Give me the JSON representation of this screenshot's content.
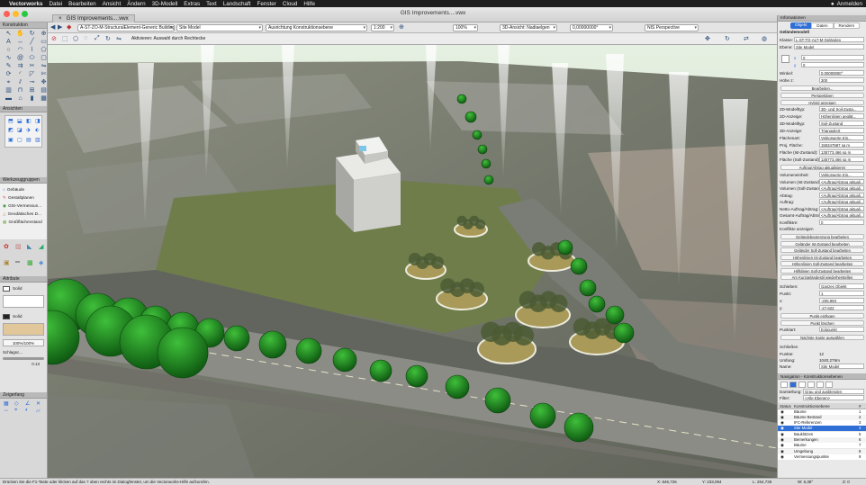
{
  "menubar": {
    "app": "Vectorworks",
    "items": [
      "Datei",
      "Bearbeiten",
      "Ansicht",
      "Ändern",
      "3D-Modell",
      "Extras",
      "Text",
      "Landschaft",
      "Fenster",
      "Cloud",
      "Hilfe"
    ],
    "user": "Anmelden"
  },
  "window": {
    "title": "GIS Improvements....vwx",
    "tab": "GIS Improvements....vwx",
    "tab_close": "×"
  },
  "view_bar": {
    "class": "A-ST-ZO-M-StructuralElement-Generic Building",
    "layer": "Site Model",
    "alignment": "Ausrichtung Konstruktionsebene",
    "scale": "1:200",
    "zoom": "100%",
    "view": "3D-Ansicht: Nadiaelgen",
    "angle": "0,00000000°",
    "projection": "NIS Perspective"
  },
  "mode_bar": {
    "hint": "Aktivieren: Auswahl durch Rechtecke"
  },
  "left_panels": {
    "construction": "Konstruktion",
    "views": "Ansichten",
    "toolsets": "Werkzeuggruppen",
    "toolset_items": [
      "Gebäude",
      "Gestaltplanen",
      "GIS-Vermessun...",
      "Geodätisches D...",
      "Großflächenstand"
    ],
    "attributes": "Attribute",
    "fill_label": "Solid",
    "pen_label": "Solid",
    "opacity": "100%/100%",
    "shadow": "Schlagsc...",
    "line_value": "0.13",
    "snapping": "Zeigerfang"
  },
  "info_panel": {
    "title": "Infomationen",
    "tabs": [
      "Objekt",
      "Daten",
      "Rendern"
    ],
    "object": "Geländemodell",
    "klasse_label": "Klasse:",
    "klasse": "L-ST-TO-ALT-M-Geländes",
    "ebene_label": "Ebene:",
    "ebene": "Site Model",
    "x_val": "0",
    "y_val": "0",
    "rows": [
      {
        "label": "Winkel:",
        "value": "0,00000000°"
      },
      {
        "label": "Höhe z:",
        "value": "300"
      }
    ],
    "buttons_top": [
      "Bearbeiten...",
      "Perspektiven",
      "Hybrid anzeigen"
    ],
    "settings": [
      {
        "label": "2D-Modelltyp:",
        "value": "3D- und Soil-Zusta..."
      },
      {
        "label": "2D-Anzeige:",
        "value": "Höhenlinien geglät..."
      },
      {
        "label": "3D-Modelltyp:",
        "value": "Soil-Zustand"
      },
      {
        "label": "3D-Anzeige:",
        "value": "Trianguliert"
      },
      {
        "label": "Flächenart:",
        "value": "Vektorwerte Ein..."
      },
      {
        "label": "Proj. Fläche:",
        "value": "155347587 sq m"
      },
      {
        "label": "Fläche (Ist-Zustand):",
        "value": "135773,466 sq m"
      },
      {
        "label": "Fläche (Soll-Zustand):",
        "value": "135773,466 sq m"
      }
    ],
    "btn_fill": "Auftrag/Abtrag aktualisieren",
    "volume": [
      {
        "label": "Volumeneinheit:",
        "value": "Vektorwerte Ein..."
      },
      {
        "label": "Volumen (Ist-Zustand):",
        "value": "<Auftrag/Abtrag aktuali..."
      },
      {
        "label": "Volumen (Soll-Zustand):",
        "value": "<Auftrag/Abtrag aktuali..."
      },
      {
        "label": "Abtrag:",
        "value": "<Auftrag/Abtrag aktuali..."
      },
      {
        "label": "Auftrag:",
        "value": "<Auftrag/Abtrag aktuali..."
      },
      {
        "label": "Netto-Auftrag/Abtrag:",
        "value": "<Auftrag/Abtrag aktuali..."
      },
      {
        "label": "Gesamt-Auftrag/Abtrag:",
        "value": "<Auftrag/Abtrag aktuali..."
      },
      {
        "label": "Konfliktre:",
        "value": "0"
      }
    ],
    "checkbox_conflicts": "Konflikte anzeigen",
    "btn_list": [
      "Geländebegrenzung bearbeiten",
      "Geländer Ist-Zustand bearbeiten",
      "Geländer Soll-Zustand bearbeiten",
      "Höhenlinien Ist-Zustand bearbeiten",
      "Höhenlinien Soll-Zustand bearbeiten",
      "Hilfslinien Soll-Zustand bearbeiten",
      "Am Kurzgeländestil wiederherstellen"
    ],
    "schieben_label": "Schieben:",
    "schieben": "Ganzes Objekt",
    "punkt_label": "Punkt:",
    "punkt": "1",
    "coords": [
      {
        "label": "x:",
        "value": "-205,993"
      },
      {
        "label": "y:",
        "value": "-27,622"
      }
    ],
    "btns_point": [
      "Punkt einfügen",
      "Punkt löschen"
    ],
    "punktart_label": "Punktart:",
    "punktart": "Eckpunkt",
    "btn_next": "Nächste Kante auswählen",
    "checkbox_close": "Schließen",
    "stats": [
      {
        "label": "Punkte:",
        "value": "12"
      },
      {
        "label": "Umfang:",
        "value": "1040,276m"
      }
    ],
    "name_label": "Name:",
    "name": "Site Model"
  },
  "nav_panel": {
    "title": "Navigation - Konstruktionsebenen",
    "darstellung_label": "Darstellung:",
    "darstellung": "Grau und ausblenden",
    "filter_label": "Filter:",
    "filter": "<Alle Ebenen>",
    "col_status": "Status",
    "col_name": "Konstruktionsebene",
    "col_num": "#",
    "rows": [
      {
        "name": "Bäume",
        "num": "1"
      },
      {
        "name": "Bäume Bestand",
        "num": "2"
      },
      {
        "name": "IFC-Referenzen",
        "num": "3"
      },
      {
        "name": "Site Model",
        "num": "4"
      },
      {
        "name": "Bauklötzen",
        "num": "5"
      },
      {
        "name": "Bemerkungen",
        "num": "6"
      },
      {
        "name": "Bäume",
        "num": "7"
      },
      {
        "name": "Umgebung",
        "num": "8"
      },
      {
        "name": "Vermessungspunkte",
        "num": "9"
      }
    ]
  },
  "status": {
    "hint": "Drücken Sie die F1-Taste oder klicken auf das ? oben rechts im Dialogfenster, um die Vectorworks-Hilfe aufzurufen.",
    "x": "X: 846,726",
    "y": "Y: 233,094",
    "l": "L: 264,726",
    "w": "W: 6,38°",
    "z": "Z: 0"
  },
  "colors": {
    "accent": "#2f6fd6",
    "menubar": "#1e1e1e",
    "tree": "#1f7a1a"
  }
}
